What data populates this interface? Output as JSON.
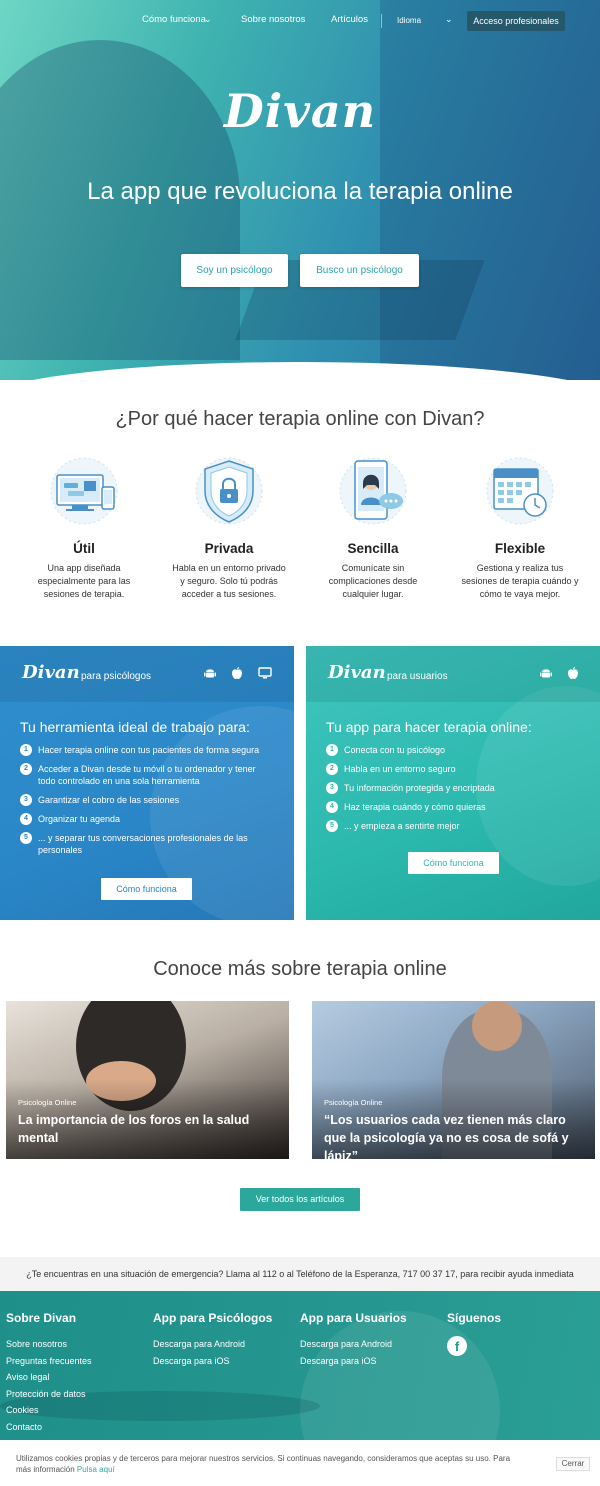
{
  "nav": {
    "how_it_works": "Cómo funciona",
    "about": "Sobre nosotros",
    "articles": "Artículos",
    "language": "Idioma",
    "pro_access": "Acceso profesionales"
  },
  "hero": {
    "logo": "Divan",
    "title": "La app que revoluciona la terapia online",
    "btn_psychologist": "Soy un psicólogo",
    "btn_search": "Busco un psicólogo"
  },
  "why": {
    "title": "¿Por qué hacer terapia online con Divan?",
    "features": [
      {
        "icon": "devices-icon",
        "title": "Útil",
        "text": "Una app diseñada especialmente para las sesiones de terapia."
      },
      {
        "icon": "shield-lock-icon",
        "title": "Privada",
        "text": "Habla en un entorno privado y seguro. Solo tú podrás acceder a tus sesiones."
      },
      {
        "icon": "phone-chat-icon",
        "title": "Sencilla",
        "text": "Comunícate sin complicaciones desde cualquier lugar."
      },
      {
        "icon": "calendar-clock-icon",
        "title": "Flexible",
        "text": "Gestiona y realiza tus sesiones de terapia cuándo y cómo te vaya mejor."
      }
    ]
  },
  "psy_panel": {
    "logo": "Divan",
    "subtitle": "para psicólogos",
    "heading": "Tu herramienta ideal de trabajo para:",
    "items": [
      "Hacer terapia online con tus pacientes de forma segura",
      "Acceder a Divan desde tu móvil o tu ordenador y tener todo controlado en una sola herramienta",
      "Garantizar el cobro de las sesiones",
      "Organizar tu agenda",
      "... y separar tus conversaciones profesionales de las personales"
    ],
    "button": "Cómo funciona"
  },
  "usr_panel": {
    "logo": "Divan",
    "subtitle": "para usuarios",
    "heading": "Tu app para hacer terapia online:",
    "items": [
      "Conecta con tu psicólogo",
      "Habla en un entorno seguro",
      "Tu información protegida y encriptada",
      "Haz terapia cuándo y cómo quieras",
      "... y empieza a sentirte mejor"
    ],
    "button": "Cómo funciona"
  },
  "articles": {
    "title": "Conoce más sobre terapia online",
    "cards": [
      {
        "category": "Psicología Online",
        "title": "La importancia de los foros en la salud mental"
      },
      {
        "category": "Psicología Online",
        "title": "“Los usuarios cada vez tienen más claro que la psicología ya no es cosa de sofá y lápiz”"
      }
    ],
    "all_button": "Ver todos los artículos"
  },
  "emergency": "¿Te encuentras en una situación de emergencia? Llama al 112 o al Teléfono de la Esperanza, 717 00 37 17, para recibir ayuda inmediata",
  "footer": {
    "col1": {
      "title": "Sobre Divan",
      "links": [
        "Sobre nosotros",
        "Preguntas frecuentes",
        "Aviso legal",
        "Protección de datos",
        "Cookies",
        "Contacto"
      ]
    },
    "col2": {
      "title": "App para Psicólogos",
      "links": [
        "Descarga para Android",
        "Descarga para iOS"
      ]
    },
    "col3": {
      "title": "App para Usuarios",
      "links": [
        "Descarga para Android",
        "Descarga para iOS"
      ]
    },
    "col4": {
      "title": "Síguenos"
    }
  },
  "cookies": {
    "text": "Utilizamos cookies propias y de terceros para mejorar nuestros servicios. Si continuas navegando, consideramos que aceptas su uso. Para más información",
    "link": "Pulsa aquí",
    "close": "Cerrar"
  },
  "colors": {
    "primary_teal": "#2ca79c",
    "psy_blue": "#2a86c7",
    "usr_teal": "#2bb8ad",
    "pro_button": "#25586b"
  }
}
